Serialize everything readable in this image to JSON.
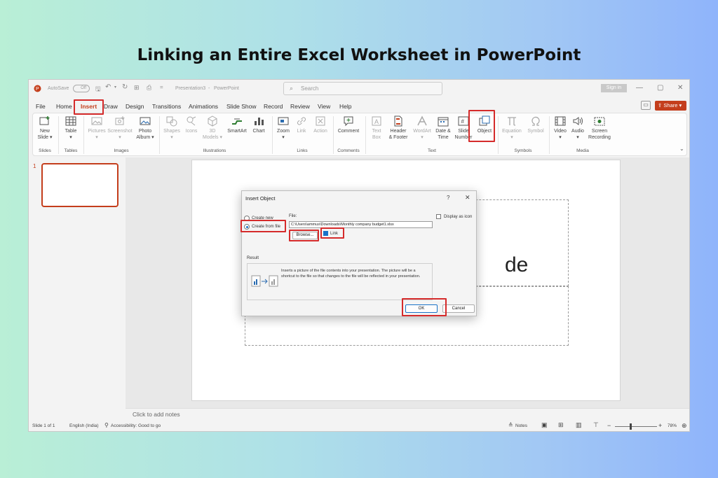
{
  "headline": "Linking an Entire Excel Worksheet in PowerPoint",
  "titlebar": {
    "autosave_label": "AutoSave",
    "autosave_state": "Off",
    "doc_title": "Presentation3",
    "separator": "-",
    "app_name": "PowerPoint",
    "search_placeholder": "Search",
    "signin_label": "Sign in",
    "minimize": "—",
    "restore": "▢",
    "close": "✕"
  },
  "tabs": [
    "File",
    "Home",
    "Insert",
    "Draw",
    "Design",
    "Transitions",
    "Animations",
    "Slide Show",
    "Record",
    "Review",
    "View",
    "Help"
  ],
  "active_tab": "Insert",
  "share_label": "Share",
  "ribbon": {
    "groups": [
      {
        "label": "Slides",
        "buttons": [
          {
            "line1": "New",
            "line2": "Slide ▾",
            "icon": "new-slide-icon",
            "enabled": true
          }
        ]
      },
      {
        "label": "Tables",
        "buttons": [
          {
            "line1": "Table",
            "line2": "▾",
            "icon": "table-icon",
            "enabled": true
          }
        ]
      },
      {
        "label": "Images",
        "buttons": [
          {
            "line1": "Pictures",
            "line2": "▾",
            "icon": "pictures-icon",
            "enabled": false
          },
          {
            "line1": "Screenshot",
            "line2": "▾",
            "icon": "screenshot-icon",
            "enabled": false
          },
          {
            "line1": "Photo",
            "line2": "Album ▾",
            "icon": "photo-album-icon",
            "enabled": true
          }
        ]
      },
      {
        "label": "Illustrations",
        "buttons": [
          {
            "line1": "Shapes",
            "line2": "▾",
            "icon": "shapes-icon",
            "enabled": false
          },
          {
            "line1": "Icons",
            "line2": "",
            "icon": "icons-icon",
            "enabled": false
          },
          {
            "line1": "3D",
            "line2": "Models ▾",
            "icon": "3d-models-icon",
            "enabled": false
          },
          {
            "line1": "SmartArt",
            "line2": "",
            "icon": "smartart-icon",
            "enabled": true
          },
          {
            "line1": "Chart",
            "line2": "",
            "icon": "chart-icon",
            "enabled": true
          }
        ]
      },
      {
        "label": "Links",
        "buttons": [
          {
            "line1": "Zoom",
            "line2": "▾",
            "icon": "zoom-icon",
            "enabled": true
          },
          {
            "line1": "Link",
            "line2": "",
            "icon": "link-icon",
            "enabled": false
          },
          {
            "line1": "Action",
            "line2": "",
            "icon": "action-icon",
            "enabled": false
          }
        ]
      },
      {
        "label": "Comments",
        "buttons": [
          {
            "line1": "Comment",
            "line2": "",
            "icon": "comment-icon",
            "enabled": true
          }
        ]
      },
      {
        "label": "Text",
        "buttons": [
          {
            "line1": "Text",
            "line2": "Box",
            "icon": "text-box-icon",
            "enabled": false
          },
          {
            "line1": "Header",
            "line2": "& Footer",
            "icon": "header-footer-icon",
            "enabled": true
          },
          {
            "line1": "WordArt",
            "line2": "▾",
            "icon": "wordart-icon",
            "enabled": false
          },
          {
            "line1": "Date &",
            "line2": "Time",
            "icon": "date-time-icon",
            "enabled": true
          },
          {
            "line1": "Slide",
            "line2": "Number",
            "icon": "slide-number-icon",
            "enabled": true
          },
          {
            "line1": "Object",
            "line2": "",
            "icon": "object-icon",
            "enabled": true
          }
        ]
      },
      {
        "label": "Symbols",
        "buttons": [
          {
            "line1": "Equation",
            "line2": "▾",
            "icon": "equation-icon",
            "enabled": false
          },
          {
            "line1": "Symbol",
            "line2": "",
            "icon": "symbol-icon",
            "enabled": false
          }
        ]
      },
      {
        "label": "Media",
        "buttons": [
          {
            "line1": "Video",
            "line2": "▾",
            "icon": "video-icon",
            "enabled": true
          },
          {
            "line1": "Audio",
            "line2": "▾",
            "icon": "audio-icon",
            "enabled": true
          },
          {
            "line1": "Screen",
            "line2": "Recording",
            "icon": "screen-recording-icon",
            "enabled": true
          }
        ]
      }
    ]
  },
  "thumbnail": {
    "number": "1"
  },
  "slide": {
    "title_fragment": "de"
  },
  "dialog": {
    "title": "Insert Object",
    "help": "?",
    "close": "✕",
    "option_create_new": "Create new",
    "option_create_from_file": "Create from file",
    "file_label": "File:",
    "file_path": "C:\\Users\\ammus\\Downloads\\Monthly company budget1.xlsx",
    "browse_label": "Browse...",
    "link_label": "Link",
    "link_checked": true,
    "display_as_icon_label": "Display as icon",
    "display_as_icon_checked": false,
    "result_label": "Result",
    "result_text": "Inserts a picture of the file contents into your presentation. The picture will be a shortcut to the file so that changes to the file will be reflected in your presentation.",
    "ok_label": "OK",
    "cancel_label": "Cancel"
  },
  "notes_placeholder": "Click to add notes",
  "status": {
    "slide_info": "Slide 1 of 1",
    "language": "English (India)",
    "accessibility": "Accessibility: Good to go",
    "notes_label": "Notes",
    "zoom_level": "78%"
  },
  "colors": {
    "accent": "#c43e1c",
    "highlight": "#d52b2b",
    "link_blue": "#1a73c8"
  }
}
